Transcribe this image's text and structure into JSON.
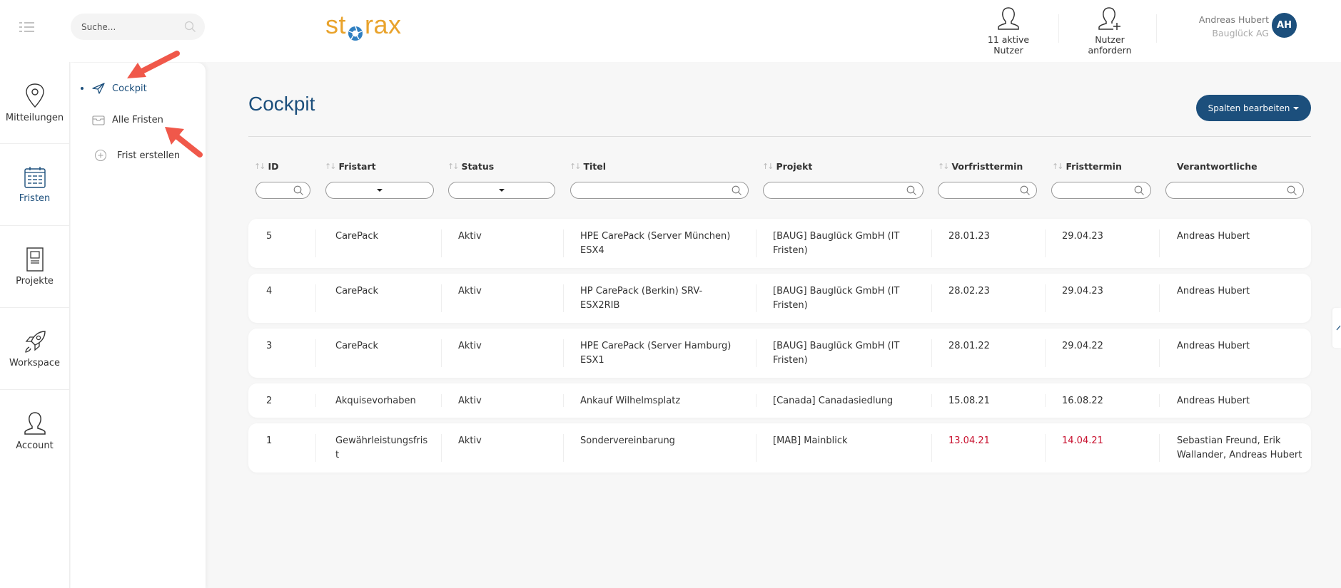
{
  "header": {
    "search_placeholder": "Suche...",
    "logo_text_left": "st",
    "logo_text_right": "rax",
    "active_users_label": "11 aktive Nutzer",
    "request_users_label": "Nutzer anfordern",
    "user_name": "Andreas Hubert",
    "user_org": "Bauglück AG",
    "avatar_initials": "AH"
  },
  "rail": {
    "items": [
      {
        "label": "Mitteilungen",
        "icon": "map-pin-icon"
      },
      {
        "label": "Fristen",
        "icon": "calendar-icon"
      },
      {
        "label": "Projekte",
        "icon": "document-icon"
      },
      {
        "label": "Workspace",
        "icon": "rocket-icon"
      },
      {
        "label": "Account",
        "icon": "user-icon"
      }
    ],
    "active": "Fristen"
  },
  "subnav": {
    "items": [
      {
        "label": "Cockpit",
        "icon": "paper-plane-icon"
      },
      {
        "label": "Alle Fristen",
        "icon": "inbox-icon"
      },
      {
        "label": "Frist erstellen",
        "icon": "plus-circle-icon"
      }
    ],
    "active": "Cockpit"
  },
  "main": {
    "title": "Cockpit",
    "columns_button": "Spalten bearbeiten",
    "columns": [
      {
        "label": "ID",
        "sortable": true,
        "filter": "search"
      },
      {
        "label": "Fristart",
        "sortable": true,
        "filter": "select"
      },
      {
        "label": "Status",
        "sortable": true,
        "filter": "select"
      },
      {
        "label": "Titel",
        "sortable": true,
        "filter": "search"
      },
      {
        "label": "Projekt",
        "sortable": true,
        "filter": "search"
      },
      {
        "label": "Vorfristtermin",
        "sortable": true,
        "filter": "search"
      },
      {
        "label": "Fristtermin",
        "sortable": true,
        "filter": "search"
      },
      {
        "label": "Verantwortliche",
        "sortable": false,
        "filter": "search"
      }
    ],
    "rows": [
      {
        "id": "5",
        "fristart": "CarePack",
        "status": "Aktiv",
        "titel": "HPE CarePack (Server München) ESX4",
        "projekt": "[BAUG] Bauglück GmbH (IT Fristen)",
        "vorfrist": "28.01.23",
        "frist": "29.04.23",
        "verantwortliche": "Andreas Hubert",
        "overdue": false
      },
      {
        "id": "4",
        "fristart": "CarePack",
        "status": "Aktiv",
        "titel": "HP CarePack (Berkin) SRV-ESX2RIB",
        "projekt": "[BAUG] Bauglück GmbH (IT Fristen)",
        "vorfrist": "28.02.23",
        "frist": "29.04.23",
        "verantwortliche": "Andreas Hubert",
        "overdue": false
      },
      {
        "id": "3",
        "fristart": "CarePack",
        "status": "Aktiv",
        "titel": "HPE CarePack (Server Hamburg) ESX1",
        "projekt": "[BAUG] Bauglück GmbH (IT Fristen)",
        "vorfrist": "28.01.22",
        "frist": "29.04.22",
        "verantwortliche": "Andreas Hubert",
        "overdue": false
      },
      {
        "id": "2",
        "fristart": "Akquisevorhaben",
        "status": "Aktiv",
        "titel": "Ankauf Wilhelmsplatz",
        "projekt": "[Canada] Canadasiedlung",
        "vorfrist": "15.08.21",
        "frist": "16.08.22",
        "verantwortliche": "Andreas Hubert",
        "overdue": false
      },
      {
        "id": "1",
        "fristart": "Gewährleistungsfrist",
        "status": "Aktiv",
        "titel": "Sondervereinbarung",
        "projekt": "[MAB] Mainblick",
        "vorfrist": "13.04.21",
        "frist": "14.04.21",
        "verantwortliche": "Sebastian Freund, Erik Wallander, Andreas Hubert",
        "overdue": true
      }
    ]
  },
  "colors": {
    "primary": "#1c4f7c",
    "logo_orange": "#e9a32c",
    "overdue_red": "#c8102e",
    "annotation_arrow": "#f0584a"
  }
}
